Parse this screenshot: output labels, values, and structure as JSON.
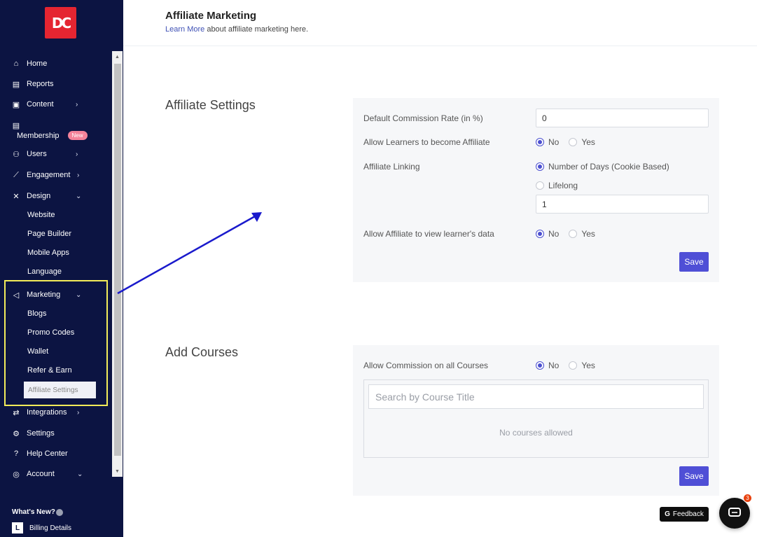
{
  "sidebar": {
    "logo_text": "DC",
    "items": [
      {
        "label": "Home",
        "icon": "home-icon"
      },
      {
        "label": "Reports",
        "icon": "file-icon"
      },
      {
        "label": "Content",
        "icon": "content-icon"
      },
      {
        "label": "Membership",
        "icon": "file-icon",
        "badge": "New"
      },
      {
        "label": "Users",
        "icon": "users-icon"
      },
      {
        "label": "Engagement",
        "icon": "chart-icon"
      },
      {
        "label": "Design",
        "icon": "design-icon"
      },
      {
        "label": "Marketing",
        "icon": "megaphone-icon"
      },
      {
        "label": "Integrations",
        "icon": "swap-icon"
      },
      {
        "label": "Settings",
        "icon": "gear-icon"
      },
      {
        "label": "Help Center",
        "icon": "help-icon"
      },
      {
        "label": "Account",
        "icon": "account-icon"
      }
    ],
    "design_sub": [
      "Website",
      "Page Builder",
      "Mobile Apps",
      "Language"
    ],
    "marketing_sub": [
      "Blogs",
      "Promo Codes",
      "Wallet",
      "Refer & Earn",
      "Affiliate Settings"
    ],
    "whats_new": "What's New?",
    "billing_badge": "L",
    "billing": "Billing Details"
  },
  "header": {
    "title": "Affiliate Marketing",
    "learn_more": "Learn More",
    "subtitle_rest": " about affiliate marketing here."
  },
  "affiliate_settings": {
    "title": "Affiliate Settings",
    "commission_label": "Default Commission Rate (in %)",
    "commission_value": "0",
    "allow_learners_label": "Allow Learners to become Affiliate",
    "linking_label": "Affiliate Linking",
    "linking_days": "Number of Days (Cookie Based)",
    "linking_lifelong": "Lifelong",
    "days_value": "1",
    "view_data_label": "Allow Affiliate to view learner's data",
    "no": "No",
    "yes": "Yes",
    "save": "Save"
  },
  "add_courses": {
    "title": "Add Courses",
    "allow_all_label": "Allow Commission on all Courses",
    "no": "No",
    "yes": "Yes",
    "search_placeholder": "Search by Course Title",
    "empty": "No courses allowed",
    "save": "Save"
  },
  "widgets": {
    "feedback_g": "G",
    "feedback": "Feedback",
    "chat_count": "3"
  },
  "colors": {
    "sidebar_bg": "#0c1442",
    "accent": "#4f4fd6",
    "highlight": "#f3ec59",
    "arrow": "#1a1acc"
  }
}
